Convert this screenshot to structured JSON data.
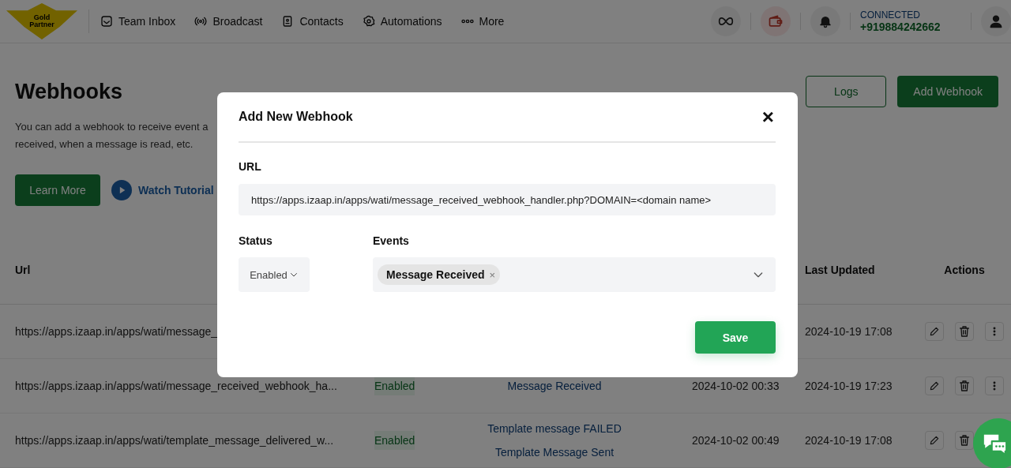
{
  "header": {
    "logo_text": "Gold Partner",
    "nav": [
      {
        "label": "Team Inbox"
      },
      {
        "label": "Broadcast"
      },
      {
        "label": "Contacts"
      },
      {
        "label": "Automations"
      },
      {
        "label": "More"
      }
    ],
    "connection_status": "CONNECTED",
    "phone": "+919884242662"
  },
  "page": {
    "title": "Webhooks",
    "description_lines": [
      "You can add a webhook to receive event a",
      "received, when a message is read, etc."
    ],
    "buttons": [
      {
        "label": "Logs",
        "kind": "outline"
      },
      {
        "label": "Add Webhook",
        "kind": "primary"
      }
    ],
    "learn_more": "Learn More",
    "watch_tutorial": "Watch Tutorial"
  },
  "table": {
    "columns": [
      {
        "label": "Url"
      },
      {},
      {},
      {},
      {
        "label": "Last Updated"
      },
      {
        "label": "Actions"
      }
    ],
    "rows": [
      {
        "url": "https://apps.izaap.in/apps/wati/message_",
        "last_updated": "2024-10-19 17:08"
      },
      {
        "url": "https://apps.izaap.in/apps/wati/message_received_webhook_ha...",
        "status": "Enabled",
        "events": [
          "Message Received"
        ],
        "created": "2024-10-02 00:33",
        "last_updated": "2024-10-19 17:23"
      },
      {
        "url": "https://apps.izaap.in/apps/wati/template_message_delivered_w...",
        "status": "Enabled",
        "events": [
          "Template message FAILED",
          "Template Message Sent"
        ],
        "created": "2024-10-02 00:49",
        "last_updated": "2024-10-19 17:08"
      }
    ]
  },
  "modal": {
    "title": "Add New Webhook",
    "close": "×",
    "url_label": "URL",
    "url_value": "https://apps.izaap.in/apps/wati/message_received_webhook_handler.php?DOMAIN=<domain name>",
    "status_label": "Status",
    "status_value": "Enabled",
    "events_label": "Events",
    "events": [
      {
        "label": "Message Received",
        "remove": "×"
      }
    ],
    "save": "Save"
  }
}
